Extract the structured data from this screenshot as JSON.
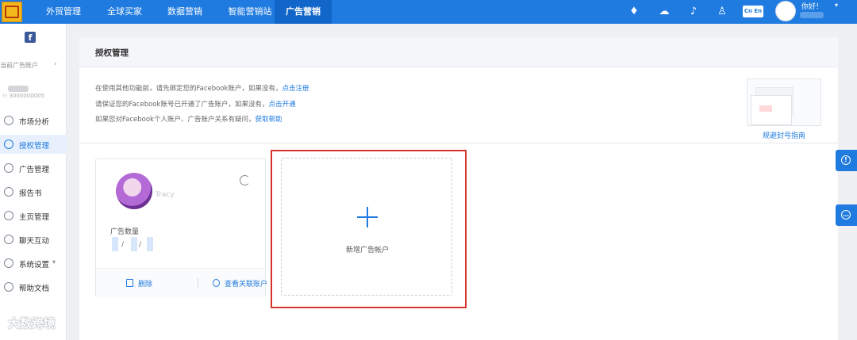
{
  "topnav": {
    "items": [
      "外贸管理",
      "全球买家",
      "数据营销",
      "智能营销站",
      "广告营销"
    ],
    "active": "广告营销",
    "lang_toggle": "Cn En",
    "greeting": "你好！"
  },
  "sidebar": {
    "current_account_label": "当前广告账户",
    "account_id": "3000000005",
    "items": [
      {
        "label": "市场分析",
        "active": false
      },
      {
        "label": "授权管理",
        "active": true
      },
      {
        "label": "广告管理",
        "active": false
      },
      {
        "label": "报告书",
        "active": false
      },
      {
        "label": "主页管理",
        "active": false
      },
      {
        "label": "聊天互动",
        "active": false
      },
      {
        "label": "系统设置",
        "active": false,
        "has_caret": true
      },
      {
        "label": "帮助文档",
        "active": false
      }
    ]
  },
  "page": {
    "title": "授权管理",
    "notices": [
      {
        "text": "在使用其他功能前，请先绑定您的Facebook账户，如果没有，",
        "link": "点击注册"
      },
      {
        "text": "请保证您的Facebook账号已开通了广告账户，如果没有，",
        "link": "点击开通"
      },
      {
        "text": "如果您对Facebook个人账户、广告账户关系有疑问，",
        "link": "获取帮助"
      }
    ],
    "guide_link": "规避封号指南"
  },
  "account_card": {
    "name": "Tracy",
    "ad_count_label": "广告数量",
    "ad_count_separators": [
      "/",
      "/"
    ],
    "delete_label": "删除",
    "view_linked_label": "查看关联账户"
  },
  "new_account": {
    "label": "新增广告帐户"
  },
  "watermark": "大数跨境",
  "colors": {
    "primary": "#1f7be0",
    "highlight": "#d6322c"
  }
}
